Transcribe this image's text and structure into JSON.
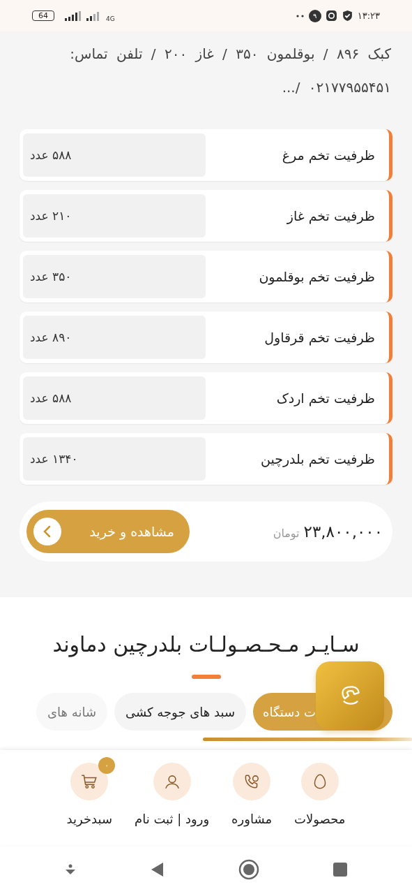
{
  "status_bar": {
    "time": "۱۳:۲۳",
    "notification_count": "۹",
    "network": "4G",
    "battery": "64"
  },
  "description": {
    "lines": [
      "کبک ۸۹۶ / بوقلمون ۳۵۰ / غاز ۲۰۰ / تلفن تماس:",
      "۰۲۱۷۷۹۵۵۴۵۱ /..."
    ]
  },
  "specs": [
    {
      "label": "ظرفیت تخم مرغ",
      "value": "۵۸۸ عدد"
    },
    {
      "label": "ظرفیت تخم غاز",
      "value": "۲۱۰ عدد"
    },
    {
      "label": "ظرفیت تخم بوقلمون",
      "value": "۳۵۰ عدد"
    },
    {
      "label": "ظرفیت تخم قرقاول",
      "value": "۸۹۰ عدد"
    },
    {
      "label": "ظرفیت تخم اردک",
      "value": "۵۸۸ عدد"
    },
    {
      "label": "ظرفیت تخم بلدرچین",
      "value": "۱۳۴۰ عدد"
    }
  ],
  "price": {
    "amount": "۲۳,۸۰۰,۰۰۰",
    "currency": "تومان",
    "button": "مشاهده و خرید"
  },
  "related": {
    "title": "سـایـر مـحـصـولـات بلدرچین دماوند",
    "tabs": [
      {
        "label": "ت دستگاه",
        "selected": true
      },
      {
        "label": "سبد های جوجه کشی",
        "selected": false
      },
      {
        "label": "شانه های",
        "selected": false
      }
    ]
  },
  "bottom_nav": [
    {
      "kind": "products",
      "label": "محصولات"
    },
    {
      "kind": "consult",
      "label": "مشاوره"
    },
    {
      "kind": "account",
      "label": "ورود | ثبت نام"
    },
    {
      "kind": "cart",
      "label": "سبدخرید",
      "badge": "۰"
    }
  ]
}
